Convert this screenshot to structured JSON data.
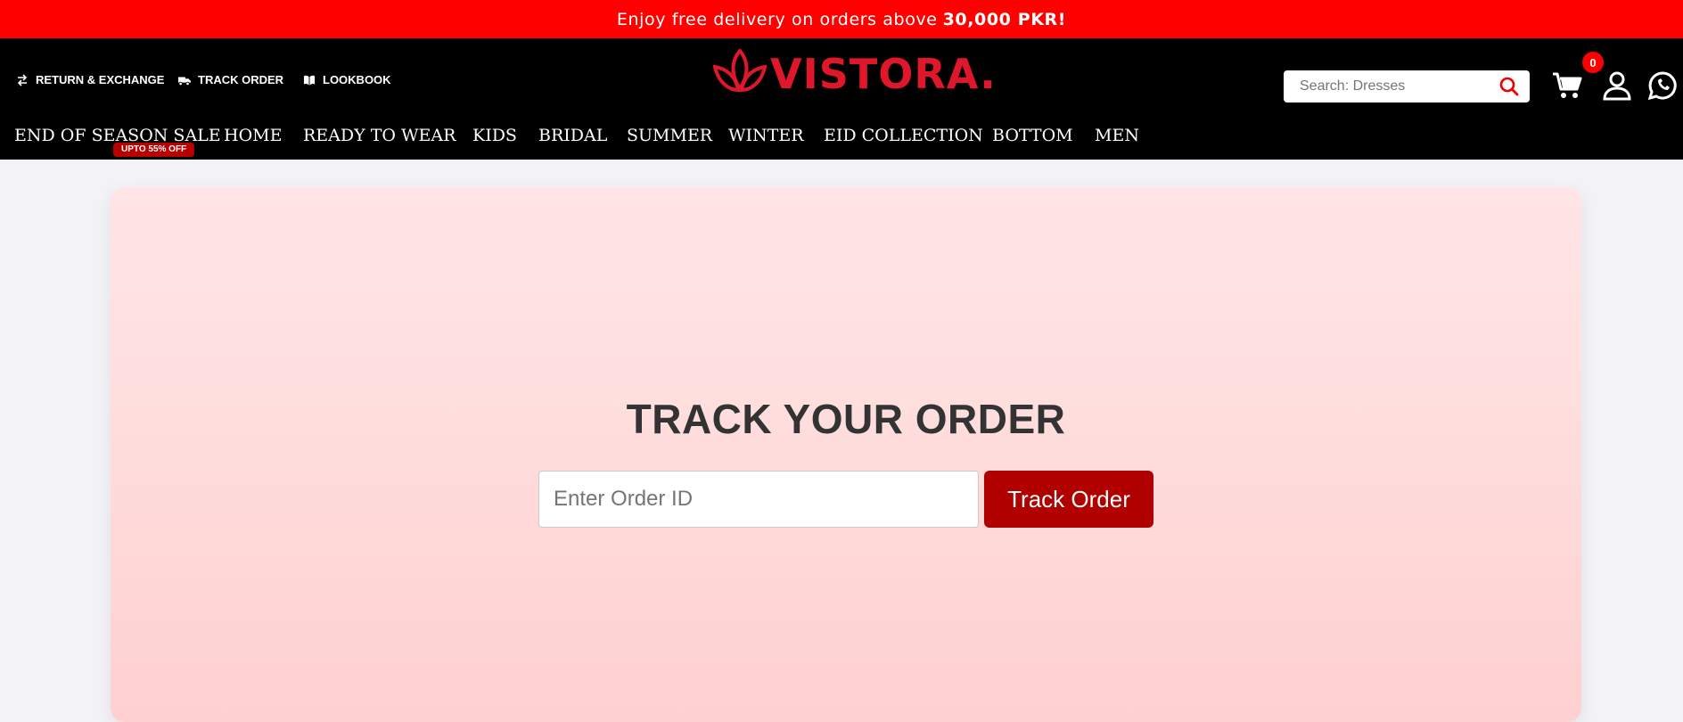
{
  "promo": {
    "text": "Enjoy free delivery on orders above",
    "highlight": "30,000 PKR!"
  },
  "utility_links": [
    {
      "label": "RETURN & EXCHANGE",
      "icon": "exchange-arrows-icon"
    },
    {
      "label": "TRACK ORDER",
      "icon": "truck-icon"
    },
    {
      "label": "LOOKBOOK",
      "icon": "book-icon"
    }
  ],
  "brand": {
    "name": "VISTORA.",
    "logo_icon": "leaf-lotus-icon",
    "color": "#e0172a"
  },
  "search": {
    "placeholder": "Search: Dresses",
    "icon": "search-icon"
  },
  "header_icons": {
    "cart_icon": "cart-icon",
    "cart_count": "0",
    "account_icon": "user-icon",
    "whatsapp_icon": "whatsapp-icon"
  },
  "nav": {
    "sale_tag": "UPTO 55% OFF",
    "items": [
      "END OF SEASON SALE",
      "HOME",
      "READY TO WEAR",
      "KIDS",
      "BRIDAL",
      "SUMMER",
      "WINTER",
      "EID COLLECTION",
      "BOTTOM",
      "MEN"
    ]
  },
  "track": {
    "title": "TRACK YOUR ORDER",
    "input_placeholder": "Enter Order ID",
    "button_label": "Track Order"
  },
  "colors": {
    "promo_bg": "#ff0000",
    "header_bg": "#000000",
    "button_bg": "#b00000",
    "card_bg": "#ffdcdc"
  }
}
